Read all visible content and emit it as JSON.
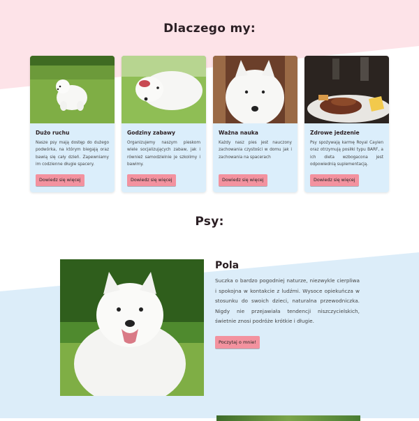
{
  "why_section": {
    "title": "Dlaczego my:",
    "cards": [
      {
        "title": "Dużo ruchu",
        "text": "Nasze psy mają dostęp do dużego podwórka, na którym biegają oraz bawią się cały dzień. Zapewniamy im codzienne długie spacery.",
        "button": "Dowiedz się więcej"
      },
      {
        "title": "Godziny zabawy",
        "text": "Organizujemy naszym pieskom wiele socjalizujących zabaw, jak i również samodzielnie je szkolimy i bawimy.",
        "button": "Dowiedz się więcej"
      },
      {
        "title": "Ważna nauka",
        "text": "Każdy nasz pies jest nauczony zachowania czystości w domu jak i zachowania na spacerach",
        "button": "Dowiedz się więcej"
      },
      {
        "title": "Zdrowe jedzenie",
        "text": "Psy spożywają karmę Royal Cayien oraz otrzymują posiłki typu BARF, a ich dieta wzbogacona jest odpowiednią suplementacją.",
        "button": "Dowiedz się więcej"
      }
    ]
  },
  "dogs_section": {
    "title": "Psy:",
    "dog": {
      "name": "Pola",
      "text": "Suczka o bardzo pogodniej naturze, niezwykle cierpliwa i spokojna w kontakcie z ludźmi. Wysoce opiekuńcza w stosunku do swoich dzieci, naturalna przewodniczka. Nigdy nie przejawiała tendencji niszczycielskich, świetnie znosi podróże krótkie i długie.",
      "button": "Poczytaj o mnie!"
    }
  },
  "colors": {
    "pink_bg": "#fde3e8",
    "blue_bg": "#dcedf9",
    "button": "#f3929f",
    "card": "#dbeefb"
  }
}
